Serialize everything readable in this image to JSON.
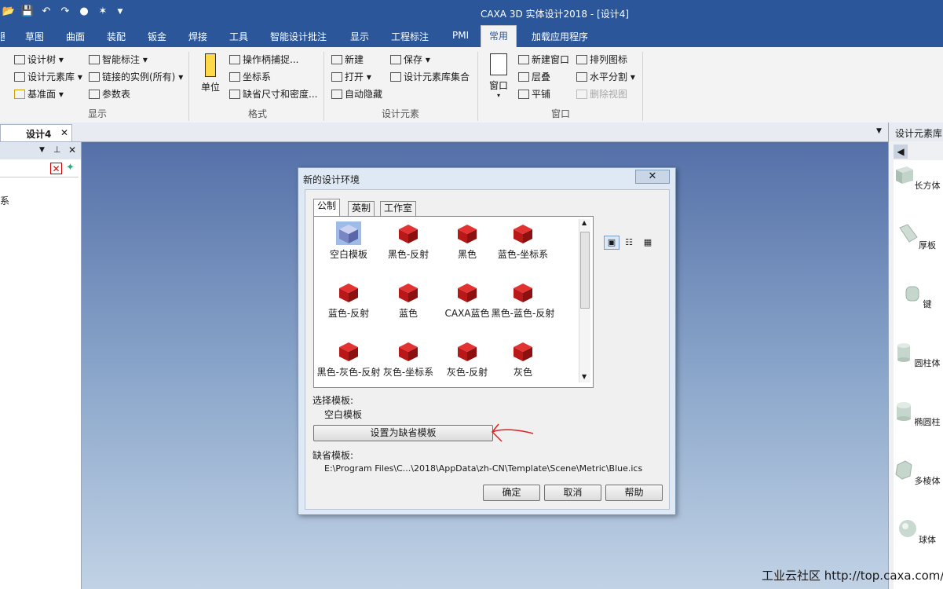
{
  "titlebar": {
    "title": "CAXA 3D 实体设计2018 - [设计4]"
  },
  "quick_access": [
    "folder-open-icon",
    "save-icon",
    "undo-icon",
    "redo-icon",
    "material-icon",
    "smart-tag-icon",
    "dropdown-icon"
  ],
  "ribbon_tabs": [
    "草图",
    "曲面",
    "装配",
    "钣金",
    "焊接",
    "工具",
    "智能设计批注",
    "显示",
    "工程标注",
    "PMI",
    "常用",
    "加载应用程序"
  ],
  "active_tab": "常用",
  "ribbon": {
    "display_group": {
      "label": "显示",
      "items": [
        "设计树",
        "设计元素库",
        "基准面",
        "智能标注",
        "链接的实例(所有)",
        "参数表"
      ]
    },
    "format_group": {
      "label": "格式",
      "unit_label": "单位",
      "items": [
        "操作柄捕捉...",
        "坐标系",
        "缺省尺寸和密度..."
      ]
    },
    "design_group": {
      "label": "设计元素",
      "items": [
        "新建",
        "打开",
        "自动隐藏",
        "保存",
        "设计元素库集合"
      ]
    },
    "window_group": {
      "label": "窗口",
      "window_label": "窗口",
      "items": [
        "新建窗口",
        "层叠",
        "平铺",
        "排列图标",
        "水平分割",
        "删除视图"
      ]
    }
  },
  "doc_tab": {
    "label": "设计4"
  },
  "left_panel": {
    "tree_text": "系"
  },
  "right_panel": {
    "title": "设计元素库",
    "items": [
      "长方体",
      "厚板",
      "键",
      "圆柱体",
      "椭圆柱",
      "多棱体",
      "球体"
    ]
  },
  "dialog": {
    "title": "新的设计环境",
    "close": "✕",
    "tabs": [
      "公制",
      "英制",
      "工作室"
    ],
    "templates": [
      "空白模板",
      "黑色-反射",
      "黑色",
      "蓝色-坐标系",
      "蓝色-反射",
      "蓝色",
      "CAXA蓝色",
      "黑色-蓝色-反射",
      "黑色-灰色-反射",
      "灰色-坐标系",
      "灰色-反射",
      "灰色"
    ],
    "selected_template_label": "选择模板:",
    "selected_template": "空白模板",
    "set_default_button": "设置为缺省模板",
    "default_template_label": "缺省模板:",
    "default_template_path": "E:\\Program Files\\C...\\2018\\AppData\\zh-CN\\Template\\Scene\\Metric\\Blue.ics",
    "ok_button": "确定",
    "cancel_button": "取消",
    "help_button": "帮助"
  },
  "watermark": "工业云社区 http://top.caxa.com/",
  "colors": {
    "ribbon_blue": "#2b579a",
    "annotation_red": "#e02020"
  }
}
